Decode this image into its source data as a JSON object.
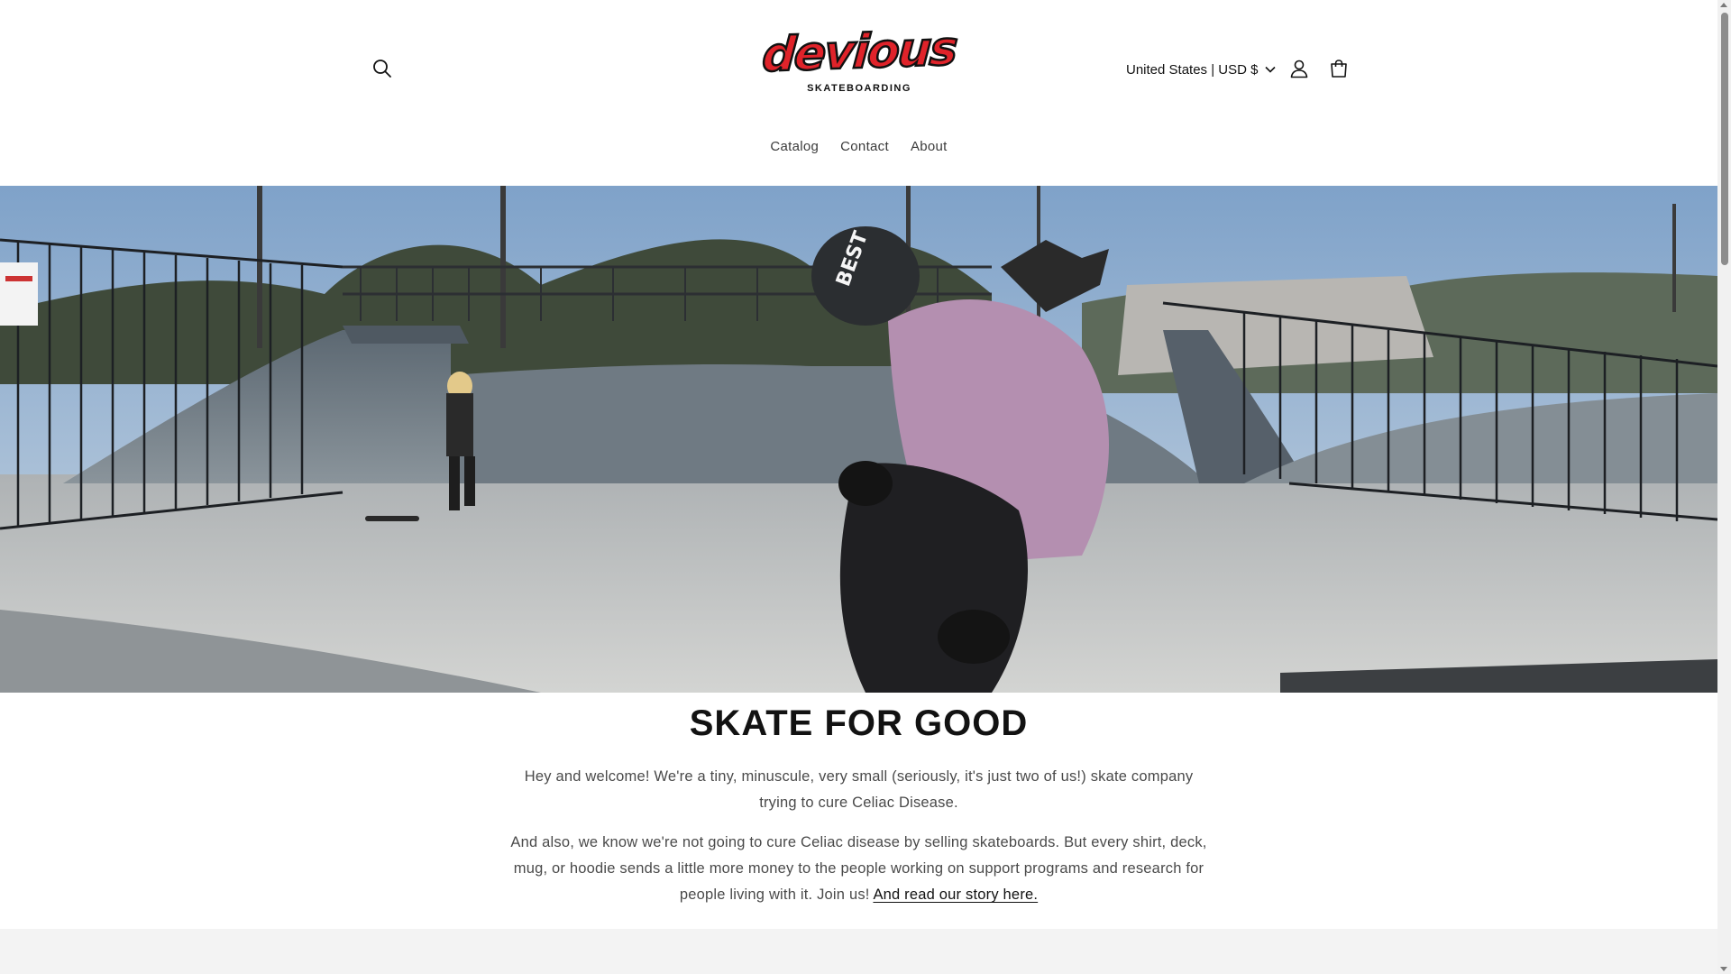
{
  "header": {
    "logo_text": "devious",
    "logo_subtext": "SKATEBOARDING",
    "search_icon": "search-icon",
    "account_icon": "account-icon",
    "cart_icon": "cart-icon",
    "locale_label": "United States | USD $",
    "locale_icon": "chevron-down-icon"
  },
  "nav": {
    "items": [
      {
        "label": "Catalog"
      },
      {
        "label": "Contact"
      },
      {
        "label": "About"
      }
    ]
  },
  "hero": {
    "image": "skatepark-hero-image",
    "helmet_text": "BEST"
  },
  "intro": {
    "heading": "SKATE FOR GOOD",
    "paragraph_1": "Hey and welcome! We're a tiny, minuscule, very small (seriously, it's just two of us!) skate company trying to cure Celiac Disease.",
    "paragraph_2": "And also, we know we're not going to cure Celiac disease by selling skateboards. But every shirt, deck, mug, or hoodie sends a little more money to the people working on support programs and research for people living with it. Join us!",
    "story_link": "And read our story here."
  },
  "colors": {
    "brand_red": "#e0232a",
    "text": "#121212",
    "muted_text": "#4a4a4a"
  }
}
